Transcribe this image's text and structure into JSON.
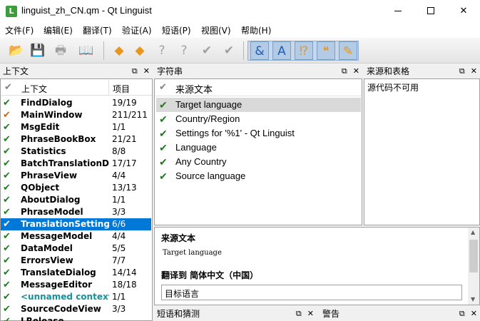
{
  "window": {
    "title": "linguist_zh_CN.qm - Qt Linguist",
    "app_icon_letter": "L"
  },
  "menu": [
    "文件(F)",
    "编辑(E)",
    "翻译(T)",
    "验证(A)",
    "短语(P)",
    "视图(V)",
    "帮助(H)"
  ],
  "toolbar_icons": [
    "open-icon",
    "save-icon",
    "print-icon",
    "phrasebook-icon",
    "prev-icon",
    "next-icon",
    "prev-unfinished-icon",
    "next-unfinished-icon",
    "done-icon",
    "done-next-icon",
    "accelerators-icon",
    "phrase-match-icon",
    "punctuation-icon",
    "quotes-icon",
    "placemarker-icon"
  ],
  "context_panel": {
    "title": "上下文",
    "col_context": "上下文",
    "col_items": "项目",
    "rows": [
      {
        "name": "FindDialog",
        "count": "19/19",
        "status": "done"
      },
      {
        "name": "MainWindow",
        "count": "211/211",
        "status": "warning"
      },
      {
        "name": "MsgEdit",
        "count": "1/1",
        "status": "done"
      },
      {
        "name": "PhraseBookBox",
        "count": "21/21",
        "status": "done"
      },
      {
        "name": "Statistics",
        "count": "8/8",
        "status": "done"
      },
      {
        "name": "BatchTranslationDi...",
        "count": "17/17",
        "status": "done"
      },
      {
        "name": "PhraseView",
        "count": "4/4",
        "status": "done"
      },
      {
        "name": "QObject",
        "count": "13/13",
        "status": "done"
      },
      {
        "name": "AboutDialog",
        "count": "1/1",
        "status": "done"
      },
      {
        "name": "PhraseModel",
        "count": "3/3",
        "status": "done"
      },
      {
        "name": "TranslationSettings...",
        "count": "6/6",
        "status": "done"
      },
      {
        "name": "MessageModel",
        "count": "4/4",
        "status": "done"
      },
      {
        "name": "DataModel",
        "count": "5/5",
        "status": "done"
      },
      {
        "name": "ErrorsView",
        "count": "7/7",
        "status": "done"
      },
      {
        "name": "TranslateDialog",
        "count": "14/14",
        "status": "done"
      },
      {
        "name": "MessageEditor",
        "count": "18/18",
        "status": "done"
      },
      {
        "name": "<unnamed context>",
        "count": "1/1",
        "status": "done"
      },
      {
        "name": "SourceCodeView",
        "count": "3/3",
        "status": "done"
      },
      {
        "name": "LRelease",
        "count": "",
        "status": "done"
      }
    ],
    "selected_index": 10
  },
  "strings_panel": {
    "title": "字符串",
    "col_source": "来源文本",
    "rows": [
      {
        "text": "Target language"
      },
      {
        "text": "Country/Region"
      },
      {
        "text": "Settings for '%1' - Qt Linguist"
      },
      {
        "text": "Language"
      },
      {
        "text": "Any Country"
      },
      {
        "text": "Source language"
      }
    ],
    "selected_index": 0
  },
  "sources_panel": {
    "title": "来源和表格",
    "message": "源代码不可用"
  },
  "editor": {
    "source_label": "来源文本",
    "source_text": "Target language",
    "translation_label": "翻译到 简体中文（中国）",
    "translation_value": "目标语言"
  },
  "phrases_panel": {
    "title": "短语和猜测"
  },
  "warnings_panel": {
    "title": "警告"
  },
  "colors": {
    "selection": "#0078d7",
    "check_green": "#1f7a1f",
    "check_orange": "#c46a15"
  }
}
